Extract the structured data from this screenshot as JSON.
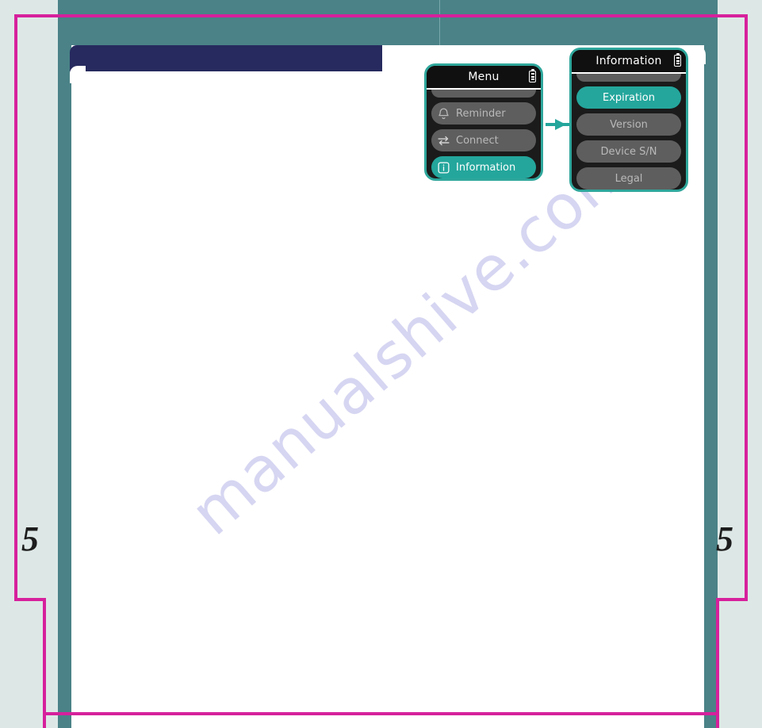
{
  "page": {
    "page_number_left": "5",
    "page_number_right": "5",
    "watermark": "manualshive.com",
    "colors": {
      "teal_band": "#4a8287",
      "pale_background": "#dde8e6",
      "navy_header": "#262a5e",
      "magenta_trim": "#d6219c",
      "device_accent": "#24a69c",
      "device_border": "#2fa79c"
    }
  },
  "screens": [
    {
      "id": "menu",
      "title": "Menu",
      "battery_icon": "battery-icon",
      "items": [
        {
          "label": "Reminder",
          "icon": "bell-icon",
          "selected": false
        },
        {
          "label": "Connect",
          "icon": "connect-icon",
          "selected": false
        },
        {
          "label": "Information",
          "icon": "info-icon",
          "selected": true
        }
      ]
    },
    {
      "id": "information",
      "title": "Information",
      "battery_icon": "battery-icon",
      "items": [
        {
          "label": "Expiration",
          "icon": null,
          "selected": true
        },
        {
          "label": "Version",
          "icon": null,
          "selected": false
        },
        {
          "label": "Device S/N",
          "icon": null,
          "selected": false
        },
        {
          "label": "Legal",
          "icon": null,
          "selected": false
        }
      ]
    }
  ],
  "connector": {
    "name": "arrow-right",
    "color": "#24a69c"
  }
}
